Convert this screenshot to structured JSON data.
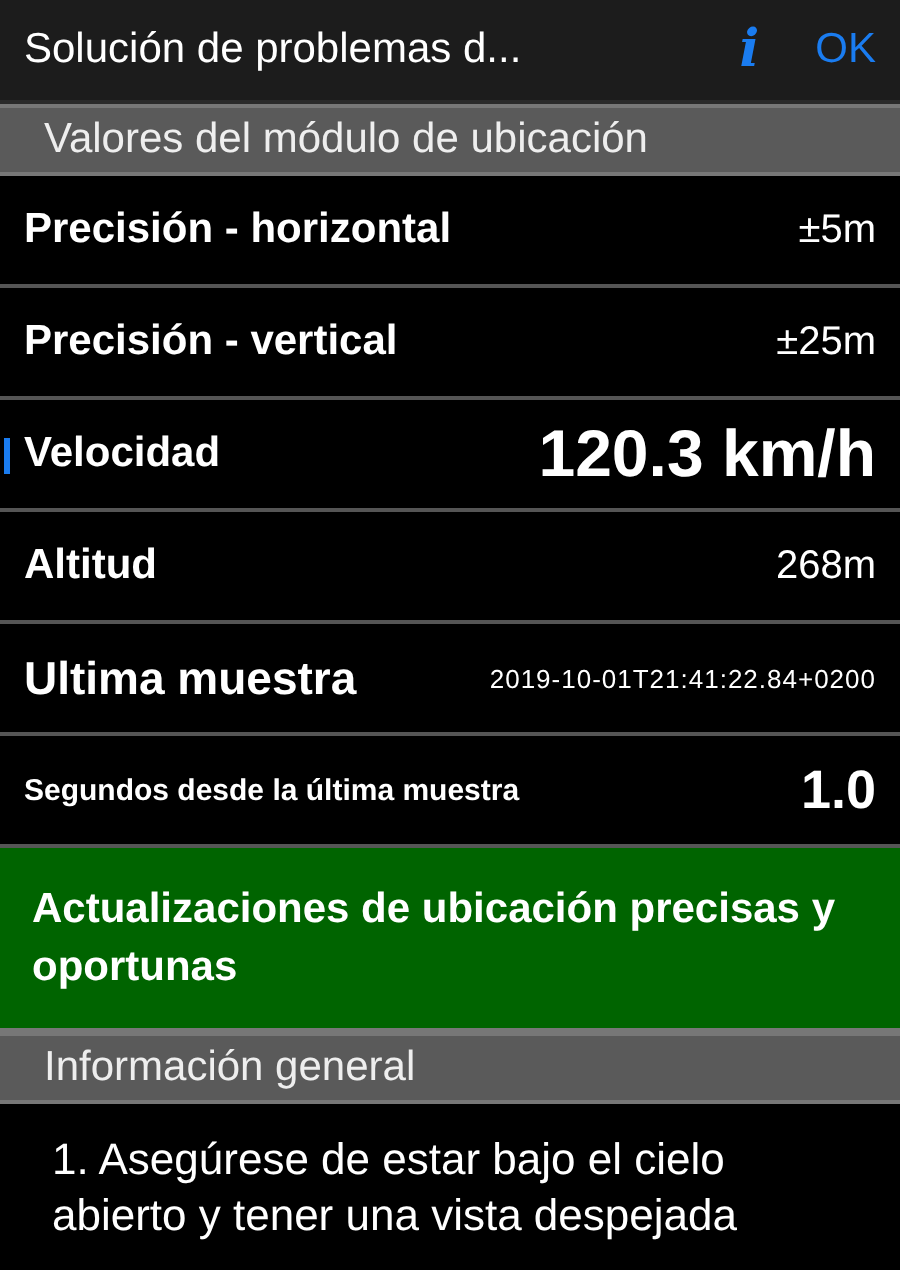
{
  "nav": {
    "title": "Solución de problemas d...",
    "info_button": "i",
    "done_button": "OK"
  },
  "sections": [
    {
      "header": "Valores del módulo de ubicación",
      "rows": [
        {
          "kind": "standard",
          "label": "Precisión - horizontal",
          "value": "±5m",
          "marked": false
        },
        {
          "kind": "standard",
          "label": "Precisión - vertical",
          "value": "±25m",
          "marked": false
        },
        {
          "kind": "large",
          "label": "Velocidad",
          "value": "120.3 km/h",
          "marked": true
        },
        {
          "kind": "standard",
          "label": "Altitud",
          "value": "268m",
          "marked": false
        },
        {
          "kind": "timestamp",
          "label": "Ultima muestra",
          "value": "2019-10-01T21:41:22.84+0200",
          "marked": false
        },
        {
          "kind": "compact",
          "label": "Segundos desde la última muestra",
          "value": "1.0",
          "marked": false
        }
      ],
      "status": "Actualizaciones de ubicación precisas y oportunas"
    },
    {
      "header": "Información general",
      "paragraphs": [
        "1. Asegúrese de estar bajo el cielo abierto y tener una vista despejada"
      ]
    }
  ]
}
